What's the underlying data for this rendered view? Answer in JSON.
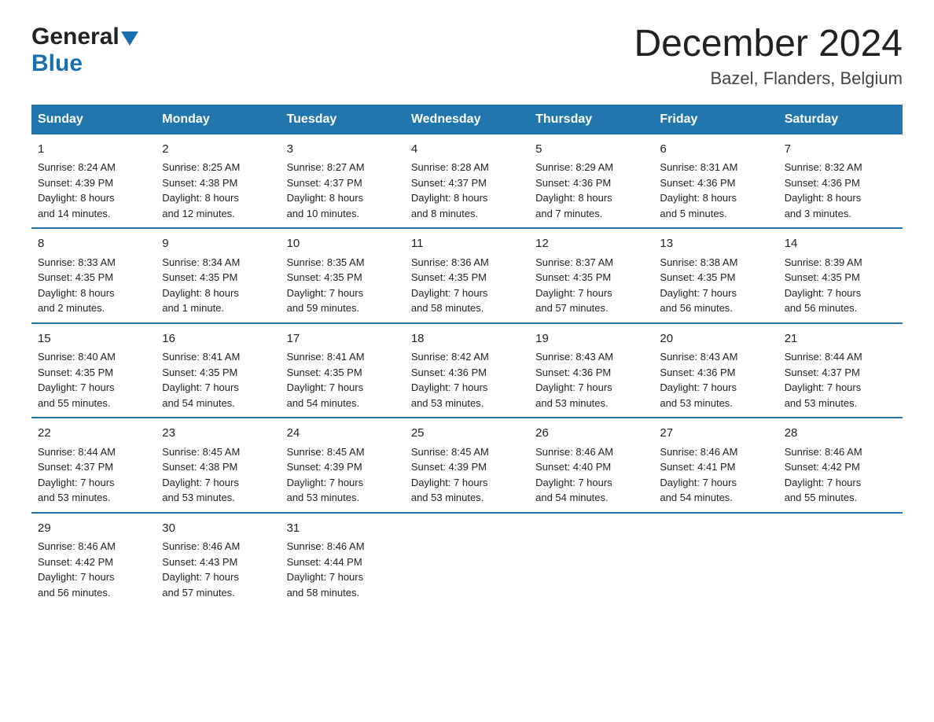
{
  "header": {
    "logo_general": "General",
    "logo_blue": "Blue",
    "month_title": "December 2024",
    "location": "Bazel, Flanders, Belgium"
  },
  "weekdays": [
    "Sunday",
    "Monday",
    "Tuesday",
    "Wednesday",
    "Thursday",
    "Friday",
    "Saturday"
  ],
  "weeks": [
    [
      {
        "day": "1",
        "info": "Sunrise: 8:24 AM\nSunset: 4:39 PM\nDaylight: 8 hours\nand 14 minutes."
      },
      {
        "day": "2",
        "info": "Sunrise: 8:25 AM\nSunset: 4:38 PM\nDaylight: 8 hours\nand 12 minutes."
      },
      {
        "day": "3",
        "info": "Sunrise: 8:27 AM\nSunset: 4:37 PM\nDaylight: 8 hours\nand 10 minutes."
      },
      {
        "day": "4",
        "info": "Sunrise: 8:28 AM\nSunset: 4:37 PM\nDaylight: 8 hours\nand 8 minutes."
      },
      {
        "day": "5",
        "info": "Sunrise: 8:29 AM\nSunset: 4:36 PM\nDaylight: 8 hours\nand 7 minutes."
      },
      {
        "day": "6",
        "info": "Sunrise: 8:31 AM\nSunset: 4:36 PM\nDaylight: 8 hours\nand 5 minutes."
      },
      {
        "day": "7",
        "info": "Sunrise: 8:32 AM\nSunset: 4:36 PM\nDaylight: 8 hours\nand 3 minutes."
      }
    ],
    [
      {
        "day": "8",
        "info": "Sunrise: 8:33 AM\nSunset: 4:35 PM\nDaylight: 8 hours\nand 2 minutes."
      },
      {
        "day": "9",
        "info": "Sunrise: 8:34 AM\nSunset: 4:35 PM\nDaylight: 8 hours\nand 1 minute."
      },
      {
        "day": "10",
        "info": "Sunrise: 8:35 AM\nSunset: 4:35 PM\nDaylight: 7 hours\nand 59 minutes."
      },
      {
        "day": "11",
        "info": "Sunrise: 8:36 AM\nSunset: 4:35 PM\nDaylight: 7 hours\nand 58 minutes."
      },
      {
        "day": "12",
        "info": "Sunrise: 8:37 AM\nSunset: 4:35 PM\nDaylight: 7 hours\nand 57 minutes."
      },
      {
        "day": "13",
        "info": "Sunrise: 8:38 AM\nSunset: 4:35 PM\nDaylight: 7 hours\nand 56 minutes."
      },
      {
        "day": "14",
        "info": "Sunrise: 8:39 AM\nSunset: 4:35 PM\nDaylight: 7 hours\nand 56 minutes."
      }
    ],
    [
      {
        "day": "15",
        "info": "Sunrise: 8:40 AM\nSunset: 4:35 PM\nDaylight: 7 hours\nand 55 minutes."
      },
      {
        "day": "16",
        "info": "Sunrise: 8:41 AM\nSunset: 4:35 PM\nDaylight: 7 hours\nand 54 minutes."
      },
      {
        "day": "17",
        "info": "Sunrise: 8:41 AM\nSunset: 4:35 PM\nDaylight: 7 hours\nand 54 minutes."
      },
      {
        "day": "18",
        "info": "Sunrise: 8:42 AM\nSunset: 4:36 PM\nDaylight: 7 hours\nand 53 minutes."
      },
      {
        "day": "19",
        "info": "Sunrise: 8:43 AM\nSunset: 4:36 PM\nDaylight: 7 hours\nand 53 minutes."
      },
      {
        "day": "20",
        "info": "Sunrise: 8:43 AM\nSunset: 4:36 PM\nDaylight: 7 hours\nand 53 minutes."
      },
      {
        "day": "21",
        "info": "Sunrise: 8:44 AM\nSunset: 4:37 PM\nDaylight: 7 hours\nand 53 minutes."
      }
    ],
    [
      {
        "day": "22",
        "info": "Sunrise: 8:44 AM\nSunset: 4:37 PM\nDaylight: 7 hours\nand 53 minutes."
      },
      {
        "day": "23",
        "info": "Sunrise: 8:45 AM\nSunset: 4:38 PM\nDaylight: 7 hours\nand 53 minutes."
      },
      {
        "day": "24",
        "info": "Sunrise: 8:45 AM\nSunset: 4:39 PM\nDaylight: 7 hours\nand 53 minutes."
      },
      {
        "day": "25",
        "info": "Sunrise: 8:45 AM\nSunset: 4:39 PM\nDaylight: 7 hours\nand 53 minutes."
      },
      {
        "day": "26",
        "info": "Sunrise: 8:46 AM\nSunset: 4:40 PM\nDaylight: 7 hours\nand 54 minutes."
      },
      {
        "day": "27",
        "info": "Sunrise: 8:46 AM\nSunset: 4:41 PM\nDaylight: 7 hours\nand 54 minutes."
      },
      {
        "day": "28",
        "info": "Sunrise: 8:46 AM\nSunset: 4:42 PM\nDaylight: 7 hours\nand 55 minutes."
      }
    ],
    [
      {
        "day": "29",
        "info": "Sunrise: 8:46 AM\nSunset: 4:42 PM\nDaylight: 7 hours\nand 56 minutes."
      },
      {
        "day": "30",
        "info": "Sunrise: 8:46 AM\nSunset: 4:43 PM\nDaylight: 7 hours\nand 57 minutes."
      },
      {
        "day": "31",
        "info": "Sunrise: 8:46 AM\nSunset: 4:44 PM\nDaylight: 7 hours\nand 58 minutes."
      },
      {
        "day": "",
        "info": ""
      },
      {
        "day": "",
        "info": ""
      },
      {
        "day": "",
        "info": ""
      },
      {
        "day": "",
        "info": ""
      }
    ]
  ]
}
